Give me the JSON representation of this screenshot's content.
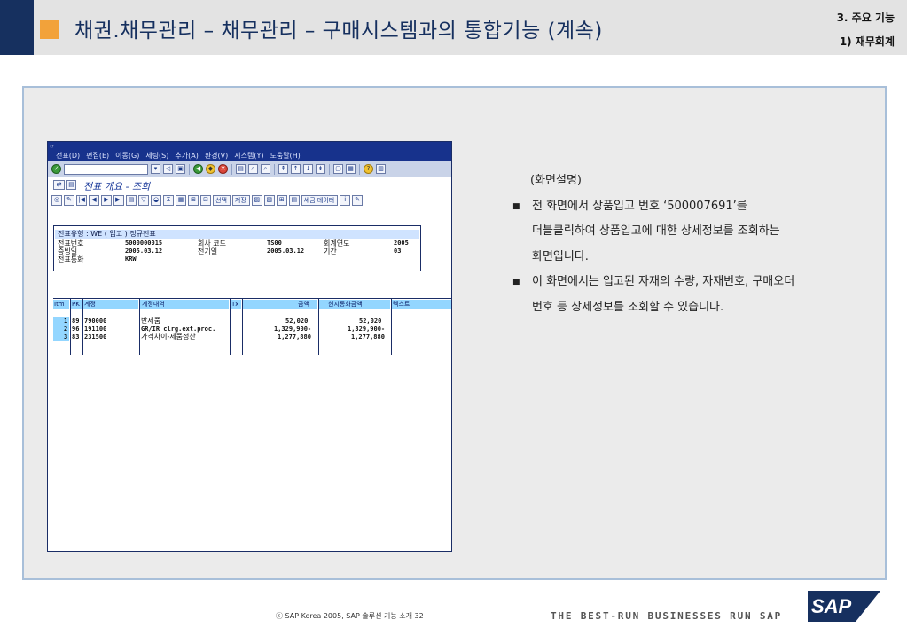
{
  "header": {
    "title": "채권.채무관리 – 채무관리 – 구매시스템과의 통합기능 (계속)",
    "section": "3. 주요 기능",
    "subsection": "1) 재무회계"
  },
  "sap": {
    "menu": [
      "전표(D)",
      "편집(E)",
      "이동(G)",
      "세팅(S)",
      "추가(A)",
      "환경(V)",
      "시스템(Y)",
      "도움말(H)"
    ],
    "screen_title": "전표 개요 - 조회",
    "buttons": {
      "select": "선택",
      "save": "저장",
      "tax_data": "세금 데이터"
    },
    "doc": {
      "doc_type_line": "전표유형 : WE ( 입고 ) 정규전표",
      "labels": {
        "doc_no": "전표번호",
        "posting_date": "증빙일",
        "currency": "전표통화",
        "company_code": "회사 코드",
        "posting_date2": "전기일",
        "fiscal_year": "회계연도",
        "period": "기간"
      },
      "values": {
        "doc_no": "5000000015",
        "posting_date": "2005.03.12",
        "currency": "KRW",
        "company_code": "TS00",
        "posting_date2": "2005.03.12",
        "fiscal_year": "2005",
        "period": "03"
      }
    },
    "table": {
      "columns": [
        "Itm",
        "PK",
        "계정",
        "계정내역",
        "Tx",
        "금액",
        "현지통화금액",
        "텍스트"
      ],
      "rows": [
        {
          "itm": "1",
          "pk": "89",
          "account": "790000",
          "desc": "반제품",
          "tx": "",
          "amount": "52,020",
          "local": "52,020",
          "text": ""
        },
        {
          "itm": "2",
          "pk": "96",
          "account": "191100",
          "desc": "GR/IR clrg.ext.proc.",
          "tx": "",
          "amount": "1,329,900-",
          "local": "1,329,900-",
          "text": ""
        },
        {
          "itm": "3",
          "pk": "83",
          "account": "231500",
          "desc": "가격차이-제품정산",
          "tx": "",
          "amount": "1,277,880",
          "local": "1,277,880",
          "text": ""
        }
      ]
    }
  },
  "description": {
    "caption": "(화면설명)",
    "bullets": [
      {
        "lines": [
          "전 화면에서 상품입고 번호 ‘500007691’를",
          "더블클릭하여 상품입고에 대한 상세정보를 조회하는",
          "화면입니다."
        ]
      },
      {
        "lines": [
          "이 화면에서는 입고된 자재의 수량, 자재번호, 구매오더",
          "번호 등 상세정보를 조회할 수 있습니다."
        ]
      }
    ]
  },
  "footer": {
    "copyright": "ⓒ  SAP Korea 2005, SAP 솔루션 기능 소개   32",
    "tagline": "THE BEST-RUN BUSINESSES RUN SAP",
    "logo": "SAP"
  },
  "colors": {
    "navy": "#16305f",
    "accent_orange": "#f2a23a",
    "sap_blue": "#17328c",
    "grid_header": "#93d6ff"
  }
}
